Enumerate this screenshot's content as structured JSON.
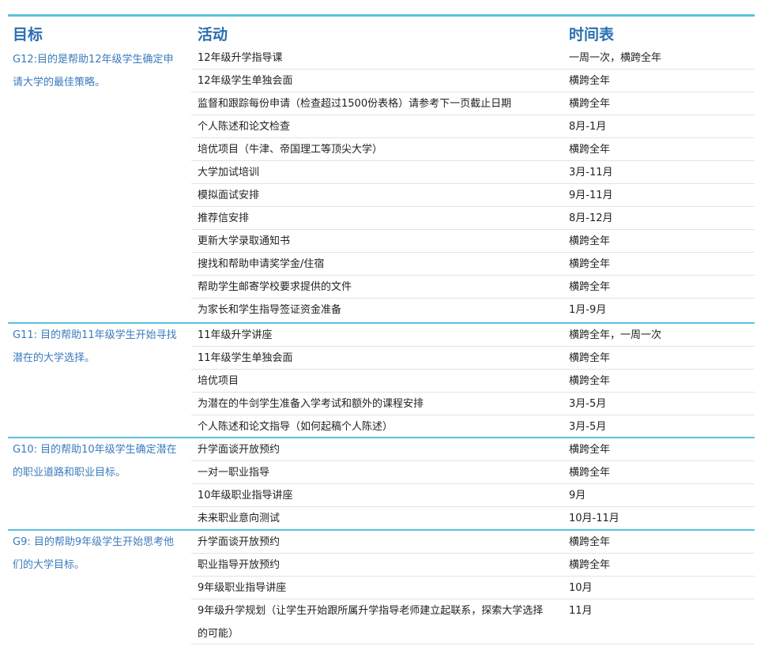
{
  "header": {
    "goal_label": "目标",
    "activity_label": "活动",
    "timeline_label": "时间表"
  },
  "sections": [
    {
      "goal": "G12:目的是帮助12年级学生确定申请大学的最佳策略。",
      "rows": [
        {
          "activity": "12年级升学指导课",
          "time": "一周一次，横跨全年"
        },
        {
          "activity": "12年级学生单独会面",
          "time": "横跨全年"
        },
        {
          "activity": "监督和跟踪每份申请（检查超过1500份表格）请参考下一页截止日期",
          "time": "横跨全年"
        },
        {
          "activity": "个人陈述和论文检查",
          "time": "8月-1月"
        },
        {
          "activity": "培优项目（牛津、帝国理工等顶尖大学）",
          "time": "横跨全年"
        },
        {
          "activity": "大学加试培训",
          "time": "3月-11月"
        },
        {
          "activity": "模拟面试安排",
          "time": "9月-11月"
        },
        {
          "activity": "推荐信安排",
          "time": "8月-12月"
        },
        {
          "activity": "更新大学录取通知书",
          "time": "横跨全年"
        },
        {
          "activity": "搜找和帮助申请奖学金/住宿",
          "time": "横跨全年"
        },
        {
          "activity": "帮助学生邮寄学校要求提供的文件",
          "time": "横跨全年"
        },
        {
          "activity": "为家长和学生指导签证资金准备",
          "time": "1月-9月"
        }
      ]
    },
    {
      "goal": "G11: 目的帮助11年级学生开始寻找潜在的大学选择。",
      "rows": [
        {
          "activity": "11年级升学讲座",
          "time": "横跨全年，一周一次"
        },
        {
          "activity": "11年级学生单独会面",
          "time": "横跨全年"
        },
        {
          "activity": "培优项目",
          "time": "横跨全年"
        },
        {
          "activity": "为潜在的牛剑学生准备入学考试和额外的课程安排",
          "time": "3月-5月"
        },
        {
          "activity": "个人陈述和论文指导（如何起稿个人陈述）",
          "time": "3月-5月"
        }
      ]
    },
    {
      "goal": "G10: 目的帮助10年级学生确定潜在的职业道路和职业目标。",
      "rows": [
        {
          "activity": "升学面谈开放预约",
          "time": "横跨全年"
        },
        {
          "activity": "一对一职业指导",
          "time": "横跨全年"
        },
        {
          "activity": "10年级职业指导讲座",
          "time": "9月"
        },
        {
          "activity": "未来职业意向测试",
          "time": "10月-11月"
        }
      ]
    },
    {
      "goal": "G9: 目的帮助9年级学生开始思考他们的大学目标。",
      "rows": [
        {
          "activity": "升学面谈开放预约",
          "time": "横跨全年"
        },
        {
          "activity": "职业指导开放预约",
          "time": "横跨全年"
        },
        {
          "activity": "9年级职业指导讲座",
          "time": "10月"
        },
        {
          "activity": "9年级升学规划（让学生开始跟所属升学指导老师建立起联系，探索大学选择的可能）",
          "time": "11月"
        }
      ]
    }
  ]
}
